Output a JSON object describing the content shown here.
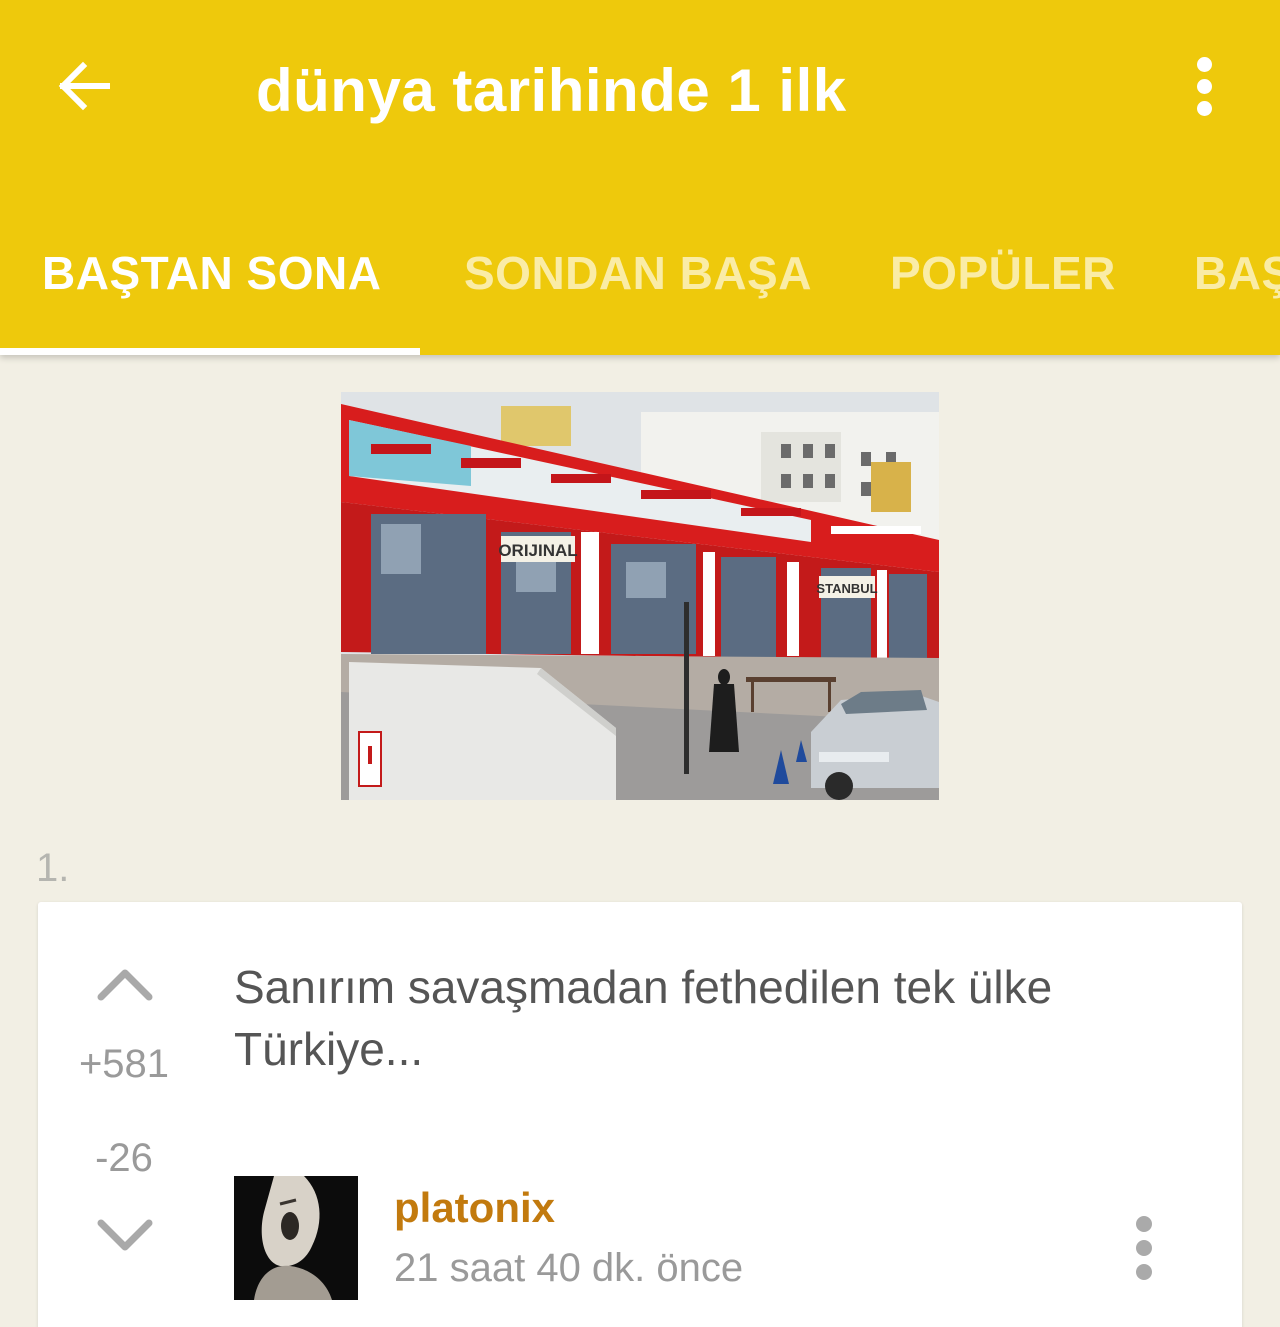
{
  "topbar": {
    "title": "dünya tarihinde 1 ilk",
    "back_icon": "arrow-left-icon",
    "menu_icon": "more-vertical-icon",
    "background_color": "#eec90c"
  },
  "tabs": [
    {
      "label": "BAŞTAN SONA",
      "active": true
    },
    {
      "label": "SONDAN BAŞA",
      "active": false
    },
    {
      "label": "POPÜLER",
      "active": false
    },
    {
      "label": "BAŞ",
      "active": false
    }
  ],
  "image": {
    "sign_text_1": "ORIJINAL",
    "sign_text_2": "STANBUL"
  },
  "entry": {
    "index": "1.",
    "text": "Sanırım savaşmadan fethedilen tek ülke Türkiye...",
    "upvote_icon": "chevron-up-icon",
    "downvote_icon": "chevron-down-icon",
    "upvotes": "+581",
    "downvotes": "-26",
    "author": "platonix",
    "timestamp": "21 saat 40 dk. önce",
    "author_color": "#c27a0e",
    "menu_icon": "more-vertical-icon"
  }
}
